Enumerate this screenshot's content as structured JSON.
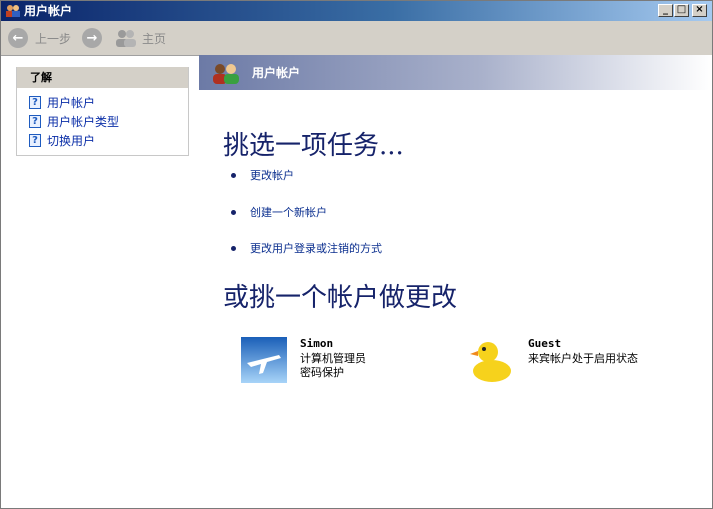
{
  "window": {
    "title": "用户帐户"
  },
  "toolbar": {
    "back_label": "上一步",
    "home_label": "主页"
  },
  "sidebar": {
    "header": "了解",
    "items": [
      {
        "label": "用户帐户"
      },
      {
        "label": "用户帐户类型"
      },
      {
        "label": "切换用户"
      }
    ]
  },
  "banner": {
    "title": "用户帐户"
  },
  "tasks": {
    "heading": "挑选一项任务...",
    "items": [
      {
        "label": "更改帐户"
      },
      {
        "label": "创建一个新帐户"
      },
      {
        "label": "更改用户登录或注销的方式"
      }
    ]
  },
  "accounts": {
    "heading": "或挑一个帐户做更改",
    "list": [
      {
        "name": "Simon",
        "line1": "计算机管理员",
        "line2": "密码保护",
        "picture": "airplane-picture"
      },
      {
        "name": "Guest",
        "line1": "来宾帐户处于启用状态",
        "picture": "duck-picture"
      }
    ]
  },
  "colors": {
    "title_bar": "#0a246a",
    "heading": "#16236a",
    "link": "#0b2fa8"
  }
}
